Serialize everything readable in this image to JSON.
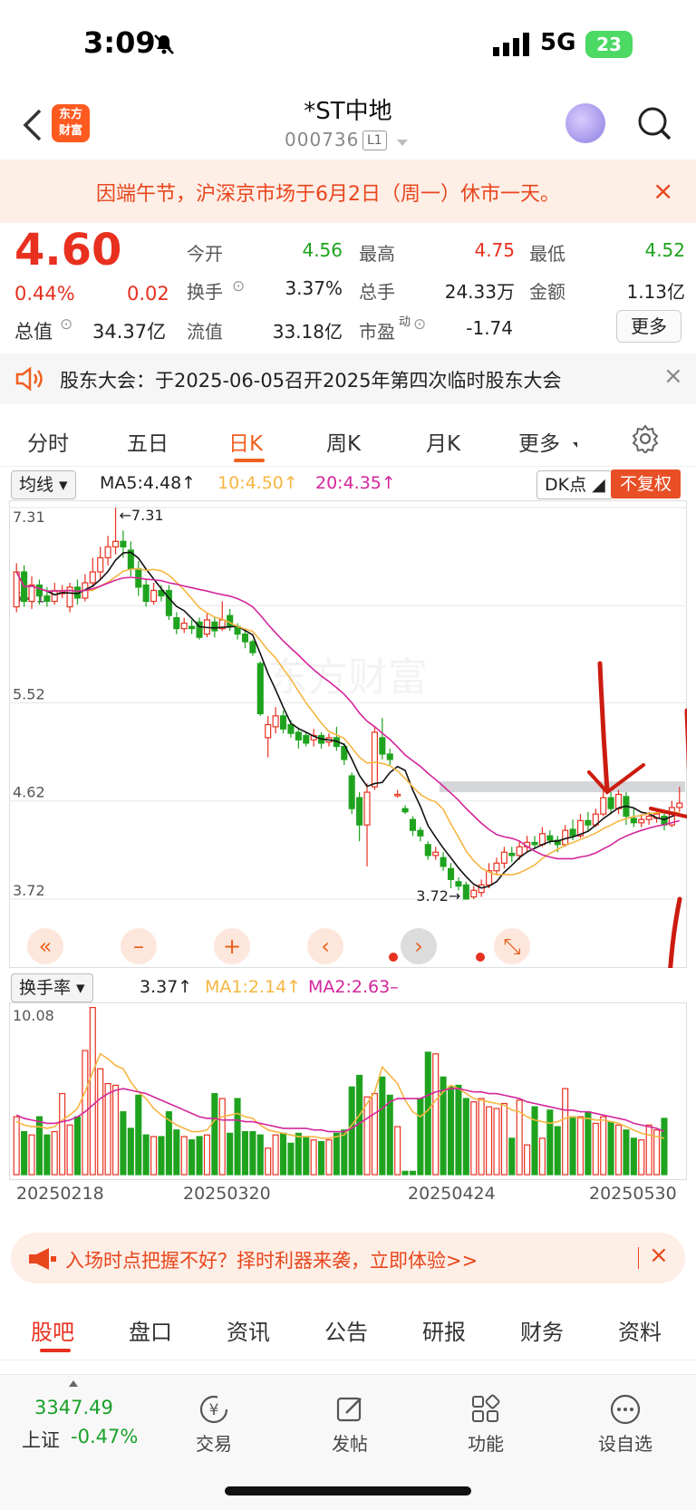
{
  "status_bar": {
    "time": "3:09",
    "network": "5G",
    "battery": "23"
  },
  "header": {
    "title": "*ST中地",
    "code": "000736",
    "level": "L1",
    "logo_text": "东方财富"
  },
  "notice": {
    "text": "因端午节，沪深京市场于6月2日（周一）休市一天。",
    "close": "×"
  },
  "quote": {
    "price": "4.60",
    "pct": "0.44%",
    "change": "0.02",
    "open_label": "今开",
    "open": "4.56",
    "high_label": "最高",
    "high": "4.75",
    "low_label": "最低",
    "low": "4.52",
    "turnover_label": "换手",
    "turnover": "3.37%",
    "volume_label": "总手",
    "volume": "24.33万",
    "amount_label": "金额",
    "amount": "1.13亿",
    "mktcap_label": "总值",
    "mktcap": "34.37亿",
    "float_label": "流值",
    "float": "33.18亿",
    "pe_label": "市盈",
    "pe_sup": "动",
    "pe": "-1.74",
    "more": "更多"
  },
  "meeting": {
    "text": "股东大会：于2025-06-05召开2025年第四次临时股东大会",
    "close": "×"
  },
  "tabs": [
    "分时",
    "五日",
    "日K",
    "周K",
    "月K",
    "更多"
  ],
  "active_tab": "日K",
  "chart_head": {
    "ma_type": "均线",
    "ma5": "MA5:4.48↑",
    "ma10": "10:4.50↑",
    "ma20": "20:4.35↑",
    "dk": "DK点",
    "fq": "不复权"
  },
  "vol_head": {
    "type": "换手率",
    "val": "3.37↑",
    "ma1": "MA1:2.14↑",
    "ma2": "MA2:2.63–"
  },
  "colors": {
    "up": "#e8301f",
    "down": "#1fa31f",
    "ma5": "#111111",
    "ma10": "#f5b642",
    "ma20": "#d4269b",
    "accent": "#f06020"
  },
  "chart_data": {
    "type": "candlestick",
    "ylim": [
      3.72,
      7.31
    ],
    "y_ticks": [
      "7.31",
      "6.41",
      "5.52",
      "4.62",
      "3.72"
    ],
    "x_labels": [
      "20250218",
      "20250320",
      "20250424",
      "20250530"
    ],
    "max_mark": "←7.31",
    "min_mark": "3.72→",
    "candles": [
      [
        6.4,
        6.72,
        6.8,
        6.35
      ],
      [
        6.72,
        6.45,
        6.78,
        6.4
      ],
      [
        6.45,
        6.6,
        6.68,
        6.38
      ],
      [
        6.6,
        6.5,
        6.65,
        6.42
      ],
      [
        6.5,
        6.45,
        6.58,
        6.4
      ],
      [
        6.45,
        6.55,
        6.62,
        6.42
      ],
      [
        6.52,
        6.55,
        6.6,
        6.48
      ],
      [
        6.4,
        6.58,
        6.62,
        6.35
      ],
      [
        6.58,
        6.48,
        6.65,
        6.42
      ],
      [
        6.48,
        6.62,
        6.7,
        6.45
      ],
      [
        6.62,
        6.72,
        6.85,
        6.58
      ],
      [
        6.72,
        6.85,
        6.95,
        6.65
      ],
      [
        6.85,
        6.95,
        7.05,
        6.78
      ],
      [
        6.95,
        7.0,
        7.31,
        6.88
      ],
      [
        7.0,
        6.95,
        7.1,
        6.85
      ],
      [
        6.92,
        6.75,
        7.0,
        6.68
      ],
      [
        6.75,
        6.58,
        6.82,
        6.5
      ],
      [
        6.6,
        6.45,
        6.65,
        6.4
      ],
      [
        6.45,
        6.55,
        6.62,
        6.42
      ],
      [
        6.55,
        6.5,
        6.6,
        6.45
      ],
      [
        6.55,
        6.32,
        6.6,
        6.28
      ],
      [
        6.3,
        6.2,
        6.35,
        6.15
      ],
      [
        6.2,
        6.25,
        6.3,
        6.16
      ],
      [
        6.22,
        6.2,
        6.28,
        6.15
      ],
      [
        6.26,
        6.12,
        6.3,
        6.1
      ],
      [
        6.15,
        6.28,
        6.35,
        6.12
      ],
      [
        6.26,
        6.18,
        6.3,
        6.12
      ],
      [
        6.2,
        6.28,
        6.45,
        6.18
      ],
      [
        6.32,
        6.22,
        6.38,
        6.18
      ],
      [
        6.22,
        6.15,
        6.25,
        6.1
      ],
      [
        6.15,
        6.08,
        6.18,
        6.02
      ],
      [
        6.08,
        5.98,
        6.1,
        5.95
      ],
      [
        5.88,
        5.42,
        5.9,
        5.4
      ],
      [
        5.2,
        5.32,
        5.4,
        5.02
      ],
      [
        5.3,
        5.4,
        5.48,
        5.24
      ],
      [
        5.4,
        5.28,
        5.45,
        5.24
      ],
      [
        5.32,
        5.24,
        5.36,
        5.2
      ],
      [
        5.25,
        5.18,
        5.28,
        5.1
      ],
      [
        5.22,
        5.15,
        5.25,
        5.12
      ],
      [
        5.18,
        5.22,
        5.28,
        5.12
      ],
      [
        5.22,
        5.15,
        5.25,
        5.1
      ],
      [
        5.16,
        5.2,
        5.24,
        5.12
      ],
      [
        5.2,
        5.12,
        5.3,
        5.08
      ],
      [
        5.12,
        5.0,
        5.15,
        4.95
      ],
      [
        4.85,
        4.55,
        4.88,
        4.5
      ],
      [
        4.65,
        4.4,
        4.7,
        4.25
      ],
      [
        4.4,
        4.7,
        4.78,
        4.02
      ],
      [
        4.75,
        5.25,
        5.3,
        4.72
      ],
      [
        5.2,
        5.05,
        5.38,
        5.0
      ],
      [
        5.05,
        5.0,
        5.1,
        4.95
      ],
      [
        4.68,
        4.68,
        4.72,
        4.65
      ],
      [
        4.55,
        4.52,
        4.58,
        4.5
      ],
      [
        4.45,
        4.35,
        4.48,
        4.3
      ],
      [
        4.35,
        4.3,
        4.38,
        4.25
      ],
      [
        4.22,
        4.12,
        4.25,
        4.08
      ],
      [
        4.12,
        4.15,
        4.2,
        4.08
      ],
      [
        4.1,
        4.02,
        4.15,
        3.98
      ],
      [
        4.0,
        3.9,
        4.05,
        3.82
      ],
      [
        3.88,
        3.84,
        3.92,
        3.8
      ],
      [
        3.85,
        3.72,
        3.88,
        3.72
      ],
      [
        3.74,
        3.8,
        3.84,
        3.72
      ],
      [
        3.78,
        3.85,
        3.9,
        3.74
      ],
      [
        3.85,
        3.98,
        4.05,
        3.82
      ],
      [
        3.98,
        4.05,
        4.1,
        3.95
      ],
      [
        4.05,
        4.15,
        4.2,
        4.0
      ],
      [
        4.14,
        4.12,
        4.2,
        4.06
      ],
      [
        4.12,
        4.2,
        4.25,
        4.08
      ],
      [
        4.2,
        4.24,
        4.3,
        4.15
      ],
      [
        4.24,
        4.22,
        4.3,
        4.18
      ],
      [
        4.22,
        4.32,
        4.38,
        4.2
      ],
      [
        4.3,
        4.26,
        4.35,
        4.22
      ],
      [
        4.26,
        4.22,
        4.3,
        4.15
      ],
      [
        4.22,
        4.35,
        4.4,
        4.2
      ],
      [
        4.36,
        4.3,
        4.45,
        4.26
      ],
      [
        4.3,
        4.44,
        4.5,
        4.28
      ],
      [
        4.44,
        4.4,
        4.52,
        4.35
      ],
      [
        4.4,
        4.5,
        4.55,
        4.38
      ],
      [
        4.5,
        4.65,
        4.75,
        4.48
      ],
      [
        4.65,
        4.55,
        4.7,
        4.5
      ],
      [
        4.55,
        4.68,
        4.72,
        4.5
      ],
      [
        4.66,
        4.48,
        4.7,
        4.4
      ],
      [
        4.46,
        4.42,
        4.55,
        4.38
      ],
      [
        4.42,
        4.45,
        4.5,
        4.38
      ],
      [
        4.45,
        4.48,
        4.52,
        4.4
      ],
      [
        4.46,
        4.5,
        4.55,
        4.42
      ],
      [
        4.48,
        4.4,
        4.52,
        4.35
      ],
      [
        4.4,
        4.56,
        4.62,
        4.38
      ],
      [
        4.56,
        4.6,
        4.75,
        4.52
      ]
    ],
    "vol_ylim": [
      0,
      10.08
    ],
    "vol_ytick": "10.08",
    "turnover": [
      3.5,
      2.6,
      2.4,
      3.5,
      2.4,
      2.6,
      4.9,
      3.0,
      3.5,
      7.5,
      10.1,
      6.4,
      5.5,
      5.4,
      3.8,
      2.8,
      4.8,
      2.4,
      2.3,
      2.3,
      3.8,
      2.7,
      2.3,
      2.1,
      2.3,
      2.4,
      4.9,
      4.6,
      2.5,
      4.6,
      2.6,
      2.6,
      2.4,
      1.6,
      2.4,
      2.5,
      1.9,
      2.5,
      2.3,
      2.1,
      2.0,
      2.1,
      2.5,
      2.7,
      5.3,
      6.0,
      4.7,
      4.9,
      5.9,
      4.8,
      2.9,
      0.2,
      0.2,
      4.6,
      7.4,
      7.3,
      5.9,
      5.3,
      5.4,
      4.6,
      4.4,
      4.6,
      4.1,
      4.0,
      4.3,
      2.2,
      4.5,
      1.8,
      4.1,
      2.2,
      3.9,
      2.9,
      5.2,
      3.5,
      3.5,
      3.8,
      3.1,
      3.5,
      3.2,
      3.0,
      2.7,
      2.2,
      2.1,
      3.0,
      2.7,
      3.4
    ]
  },
  "vol_lines": {
    "ma1": [
      3.2,
      3.0,
      2.9,
      2.9,
      2.8,
      2.9,
      3.3,
      3.6,
      4.0,
      5.0,
      6.2,
      7.3,
      7.0,
      6.6,
      6.4,
      5.6,
      5.0,
      4.6,
      4.0,
      3.6,
      3.3,
      3.0,
      2.8,
      2.6,
      2.6,
      2.7,
      3.3,
      3.5,
      3.6,
      3.7,
      3.5,
      3.4,
      3.0,
      2.7,
      2.6,
      2.5,
      2.4,
      2.3,
      2.3,
      2.3,
      2.2,
      2.2,
      2.3,
      2.4,
      3.0,
      3.6,
      4.3,
      5.0,
      6.5,
      6.0,
      5.5,
      4.5,
      3.8,
      3.5,
      3.9,
      4.5,
      5.0,
      5.4,
      5.2,
      4.9,
      4.6,
      4.5,
      4.4,
      4.3,
      4.2,
      3.9,
      3.8,
      3.5,
      3.3,
      3.2,
      3.1,
      3.2,
      3.4,
      3.5,
      3.4,
      3.4,
      3.3,
      3.3,
      3.2,
      3.1,
      2.9,
      2.7,
      2.5,
      2.4,
      2.3,
      2.2
    ],
    "ma2": [
      3.6,
      3.4,
      3.3,
      3.2,
      3.1,
      3.1,
      3.2,
      3.3,
      3.5,
      3.8,
      4.2,
      4.6,
      4.9,
      5.1,
      5.2,
      5.1,
      5.0,
      4.9,
      4.7,
      4.5,
      4.3,
      4.1,
      3.9,
      3.7,
      3.5,
      3.4,
      3.4,
      3.3,
      3.3,
      3.3,
      3.2,
      3.2,
      3.1,
      3.0,
      2.9,
      2.8,
      2.8,
      2.8,
      2.8,
      2.7,
      2.7,
      2.6,
      2.6,
      2.6,
      2.8,
      3.1,
      3.4,
      3.7,
      4.0,
      4.4,
      4.6,
      4.6,
      4.6,
      4.6,
      4.8,
      5.0,
      5.1,
      5.2,
      5.2,
      5.1,
      5.0,
      5.0,
      4.9,
      4.9,
      4.8,
      4.7,
      4.6,
      4.4,
      4.3,
      4.2,
      4.1,
      4.0,
      3.9,
      3.9,
      3.8,
      3.8,
      3.7,
      3.6,
      3.5,
      3.4,
      3.3,
      3.1,
      3.0,
      2.9,
      2.8,
      2.6
    ]
  },
  "bottom_tabs": [
    "股吧",
    "盘口",
    "资讯",
    "公告",
    "研报",
    "财务",
    "资料"
  ],
  "active_bottom_tab": "股吧",
  "ad": {
    "text": "入场时点把握不好？择时利器来袭，立即体验>>",
    "close": "×"
  },
  "bottom_bar": {
    "index_value": "3347.49",
    "index_name": "上证",
    "index_pct": "-0.47%",
    "items": [
      {
        "label": "交易",
        "icon": "yen-icon"
      },
      {
        "label": "发帖",
        "icon": "edit-icon"
      },
      {
        "label": "功能",
        "icon": "grid-icon"
      },
      {
        "label": "设自选",
        "icon": "more-icon"
      }
    ]
  },
  "watermark": "东方财富"
}
